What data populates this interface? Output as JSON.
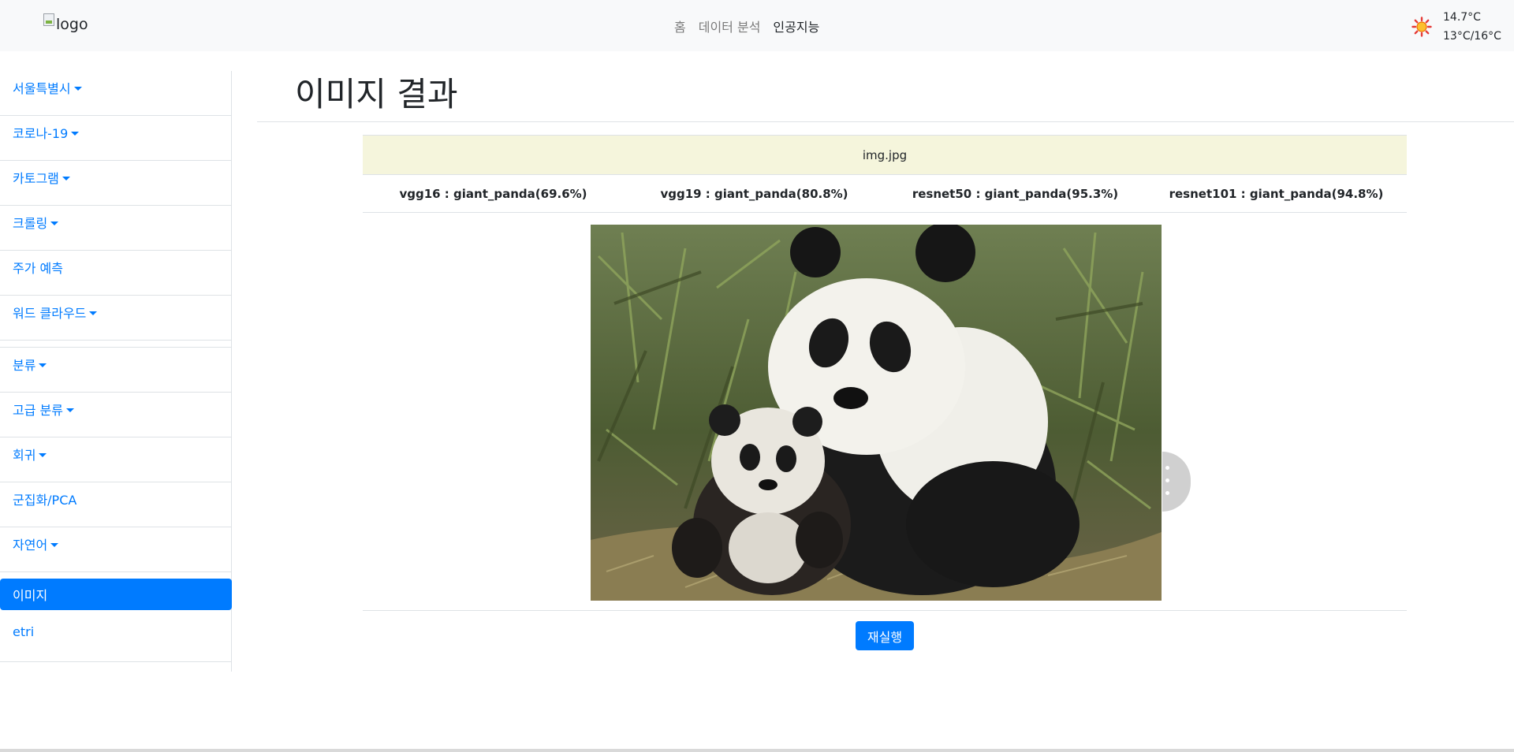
{
  "navbar": {
    "logo_alt": "logo",
    "links": [
      {
        "label": "홈"
      },
      {
        "label": "데이터 분석"
      },
      {
        "label": "인공지능",
        "active": true
      }
    ],
    "weather": {
      "icon": "sun-icon",
      "current_temp": "14.7°C",
      "range": "13°C/16°C"
    }
  },
  "sidebar": {
    "items": [
      {
        "label": "서울특별시",
        "dropdown": true
      },
      {
        "label": "코로나-19",
        "dropdown": true
      },
      {
        "label": "카토그램",
        "dropdown": true
      },
      {
        "label": "크롤링",
        "dropdown": true
      },
      {
        "label": "주가 예측",
        "dropdown": false
      },
      {
        "label": "워드 클라우드",
        "dropdown": true
      },
      {
        "label": "분류",
        "dropdown": true
      },
      {
        "label": "고급 분류",
        "dropdown": true
      },
      {
        "label": "회귀",
        "dropdown": true
      },
      {
        "label": "군집화/PCA",
        "dropdown": false
      },
      {
        "label": "자연어",
        "dropdown": true
      },
      {
        "label": "이미지",
        "dropdown": false,
        "active": true
      },
      {
        "label": "etri",
        "dropdown": false
      }
    ]
  },
  "main": {
    "title": "이미지 결과",
    "file_name": "img.jpg",
    "predictions": [
      {
        "text": "vgg16 : giant_panda(69.6%)"
      },
      {
        "text": "vgg19 : giant_panda(80.8%)"
      },
      {
        "text": "resnet50 : giant_panda(95.3%)"
      },
      {
        "text": "resnet101 : giant_panda(94.8%)"
      }
    ],
    "rerun_label": "재실행"
  },
  "colors": {
    "primary": "#007bff",
    "file_row_bg": "#f5f5dc",
    "navbar_bg": "#f8f9fa"
  }
}
